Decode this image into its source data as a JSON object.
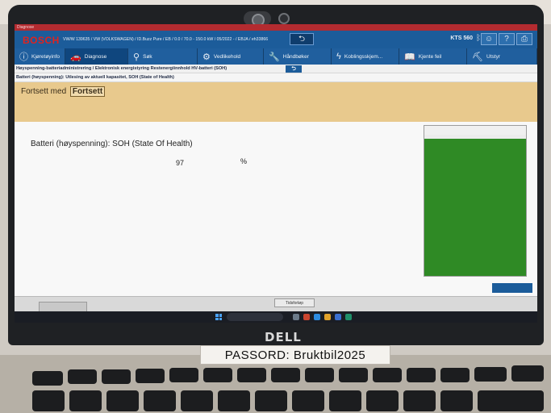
{
  "app": {
    "title": "Diagnose",
    "brand": "BOSCH",
    "vehicle_line": "VW/W 139635 / VW (VOLKSWAGEN) / ID.Buzz Pure / EB / 0.0 / 70.0 - 150.0 kW / 05/2022 - / EBJA / eh33866",
    "device": "KTS 560",
    "colors": {
      "header": "#1c5c9a",
      "prompt": "#e8c98d",
      "bar": "#2f8a25",
      "bosch_red": "#e0231f"
    }
  },
  "nav": {
    "items": [
      {
        "label": "Kjøretøyinfo",
        "icon": "info-icon"
      },
      {
        "label": "Diagnose",
        "icon": "car-icon"
      },
      {
        "label": "Søk",
        "icon": "search-icon"
      },
      {
        "label": "Vedlikehold",
        "icon": "gear-icon"
      },
      {
        "label": "Håndbøker",
        "icon": "wrench-icon"
      },
      {
        "label": "Koblingsskjem...",
        "icon": "lightning-icon"
      },
      {
        "label": "Kjente feil",
        "icon": "book-icon"
      },
      {
        "label": "Utstyr",
        "icon": "tool-icon"
      }
    ]
  },
  "breadcrumb": "Høyspenning-batteriadministrering / Elektronisk energistyring Restenergiinnhold HV-batteri (SOH)",
  "subtitle": "Batteri (høyspenning): Utlesing av aktuell kapasitet, SOH (State of Health)",
  "prompt": {
    "text": "Fortsett med",
    "button": "Fortsett"
  },
  "measurement": {
    "label": "Batteri (høyspenning): SOH (State Of Health)",
    "value": "97",
    "unit": "%",
    "fraction": 0.97
  },
  "status": {
    "tab_mid": "Tidsforløp"
  },
  "sticker": "PASSORD: Bruktbil2025",
  "laptop_brand": "DELL"
}
